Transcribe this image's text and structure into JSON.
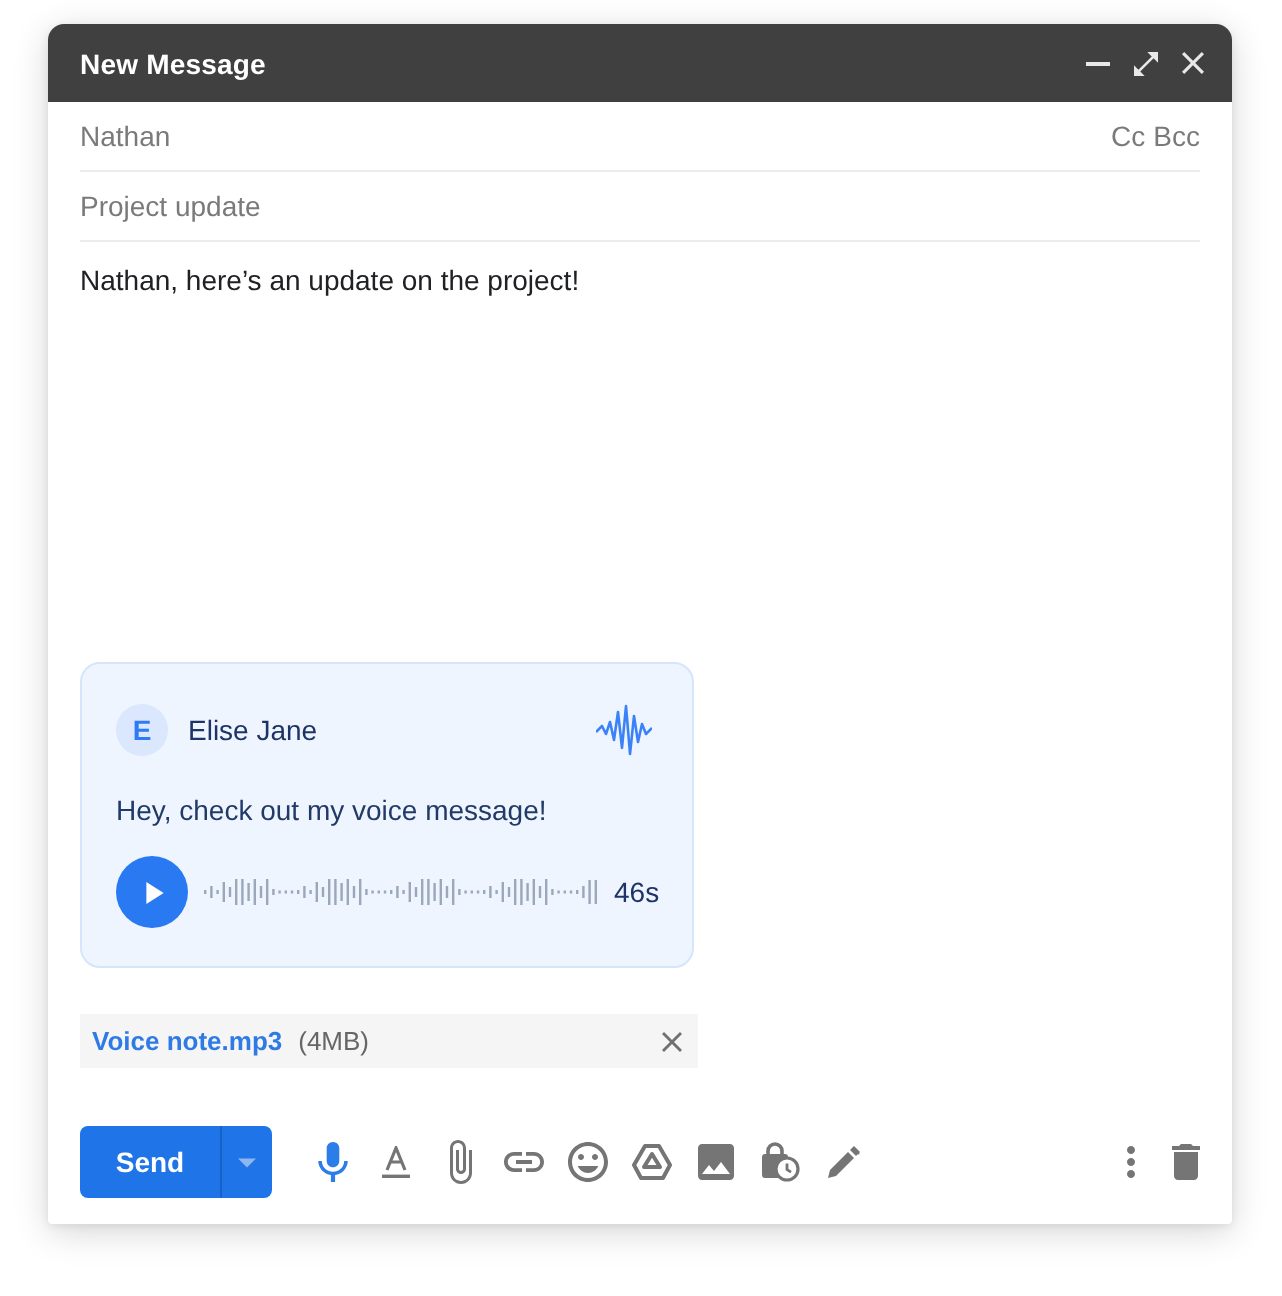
{
  "window": {
    "title": "New Message"
  },
  "to": {
    "value": "Nathan",
    "cc": "Cc",
    "bcc": "Bcc"
  },
  "subject": {
    "value": "Project update"
  },
  "body": {
    "text": "Nathan, here’s an update on the project!"
  },
  "voice_card": {
    "avatar_initial": "E",
    "sender": "Elise Jane",
    "message": "Hey, check out my voice message!",
    "duration": "46s"
  },
  "attachment": {
    "name": "Voice note.mp3",
    "size": "(4MB)"
  },
  "send_button": {
    "label": "Send"
  }
}
